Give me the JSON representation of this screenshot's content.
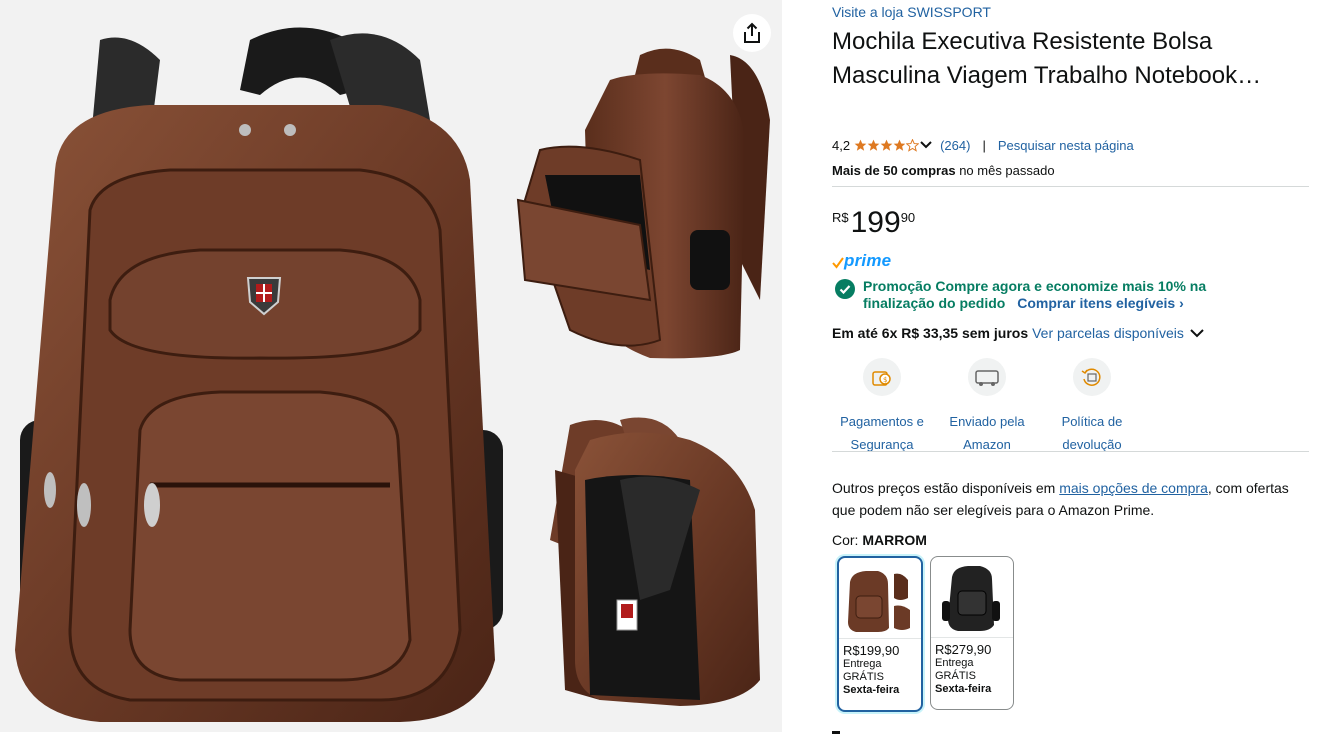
{
  "images": {
    "share_alt": "share",
    "colors": {
      "leather": "#6b3a26",
      "leather_dark": "#4a2416",
      "mesh": "#1a1a1a"
    }
  },
  "product": {
    "store_link": "Visite a loja SWISSPORT",
    "title": "Mochila Executiva Resistente Bolsa Masculina Viagem Trabalho Notebook…",
    "rating": "4,2",
    "stars_fraction": 0.84,
    "review_count": "(264)",
    "separator": "|",
    "search_page": "Pesquisar nesta página",
    "bought_bold": "Mais de 50 compras",
    "bought_rest": "no mês passado",
    "price_symbol": "R$",
    "price_whole": "199",
    "price_fraction": "90",
    "prime_label": "prime",
    "promo_text": "Promoção Compre agora e economize mais 10% na finalização do pedido",
    "promo_link": "Comprar itens elegíveis",
    "installments_bold": "Em até 6x R$ 33,35 sem juros",
    "installments_link": "Ver parcelas disponíveis",
    "badges": [
      {
        "line1": "Pagamentos e",
        "line2": "Segurança"
      },
      {
        "line1": "Enviado pela",
        "line2": "Amazon"
      },
      {
        "line1": "Política de",
        "line2": "devolução"
      }
    ],
    "others_before": "Outros preços estão disponíveis em ",
    "others_link": "mais opções de compra",
    "others_after": ", com ofertas que podem não ser elegíveis para o Amazon Prime.",
    "color_prefix": "Cor:",
    "color_value": "MARROM",
    "swatches": [
      {
        "price": "R$199,90",
        "delivery1": "Entrega",
        "delivery2": "GRÁTIS",
        "day": "Sexta-feira"
      },
      {
        "price": "R$279,90",
        "delivery1": "Entrega",
        "delivery2": "GRÁTIS",
        "day": "Sexta-feira"
      }
    ],
    "accent": "#2162a1",
    "promo_green": "#067d62",
    "star_color": "#de7921"
  }
}
